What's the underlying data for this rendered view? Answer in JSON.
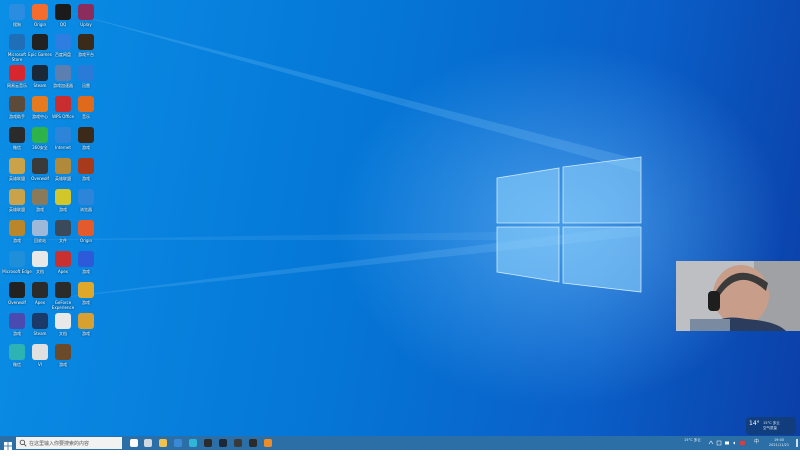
{
  "desktop": {
    "icons": [
      {
        "label": "搜狗",
        "color": "#2a8de0"
      },
      {
        "label": "Origin",
        "color": "#f56c2d"
      },
      {
        "label": "QQ",
        "color": "#1b1b1b"
      },
      {
        "label": "Uplay",
        "color": "#8a2c5c"
      },
      {
        "label": "Microsoft Store",
        "color": "#1f6fb8"
      },
      {
        "label": "Epic Games",
        "color": "#222222"
      },
      {
        "label": "百度网盘",
        "color": "#2e7de1"
      },
      {
        "label": "游戏平台",
        "color": "#3a2a1a"
      },
      {
        "label": "网易云音乐",
        "color": "#d8262e"
      },
      {
        "label": "Steam",
        "color": "#1b2838"
      },
      {
        "label": "游戏加速器",
        "color": "#5a7fb0"
      },
      {
        "label": "迅雷",
        "color": "#2a7ad8"
      },
      {
        "label": "游戏助手",
        "color": "#5c4a3a"
      },
      {
        "label": "游戏中心",
        "color": "#e57a1f"
      },
      {
        "label": "WPS Office",
        "color": "#c92d2d"
      },
      {
        "label": "音乐",
        "color": "#e06a1c"
      },
      {
        "label": "微信",
        "color": "#2b2b2b"
      },
      {
        "label": "360安全",
        "color": "#2db34a"
      },
      {
        "label": "Internet",
        "color": "#2c85d9"
      },
      {
        "label": "游戏",
        "color": "#3b2a1a"
      },
      {
        "label": "英雄联盟",
        "color": "#c9a24a"
      },
      {
        "label": "Overwolf",
        "color": "#3a3a3a"
      },
      {
        "label": "英雄联盟",
        "color": "#b08a3a"
      },
      {
        "label": "游戏",
        "color": "#a63a1a"
      },
      {
        "label": "英雄联盟",
        "color": "#c9a24a"
      },
      {
        "label": "游戏",
        "color": "#8a7a5a"
      },
      {
        "label": "游戏",
        "color": "#d3c62a"
      },
      {
        "label": "浏览器",
        "color": "#2c85d9"
      },
      {
        "label": "游戏",
        "color": "#b9872a"
      },
      {
        "label": "回收站",
        "color": "#9db8d8"
      },
      {
        "label": "文件",
        "color": "#3a4a5a"
      },
      {
        "label": "Origin",
        "color": "#e35a2d"
      },
      {
        "label": "Microsoft Edge",
        "color": "#1e8fd8"
      },
      {
        "label": "文档",
        "color": "#e8e8e8"
      },
      {
        "label": "Apex",
        "color": "#c93030"
      },
      {
        "label": "游戏",
        "color": "#2c5ad8"
      },
      {
        "label": "Overwolf",
        "color": "#222222"
      },
      {
        "label": "Apex",
        "color": "#2b2b2b"
      },
      {
        "label": "GeForce Experience",
        "color": "#2b2b2b"
      },
      {
        "label": "游戏",
        "color": "#e0a82a"
      },
      {
        "label": "游戏",
        "color": "#4a4ab0"
      },
      {
        "label": "Steam",
        "color": "#1b3a6a"
      },
      {
        "label": "文档",
        "color": "#e8e8e8"
      },
      {
        "label": "游戏",
        "color": "#d8a030"
      },
      {
        "label": "微信",
        "color": "#2db3b3"
      },
      {
        "label": "VI",
        "color": "#e0e0e0"
      },
      {
        "label": "游戏",
        "color": "#6a4a2a"
      }
    ]
  },
  "taskbar": {
    "search_placeholder": "在这里输入你要搜索的内容",
    "apps": [
      {
        "name": "task-view",
        "color": "#ffffff"
      },
      {
        "name": "widgets",
        "color": "#d0d8e0"
      },
      {
        "name": "file-explorer",
        "color": "#f2c14e"
      },
      {
        "name": "mail",
        "color": "#3a8ad8"
      },
      {
        "name": "edge",
        "color": "#2fb6d8"
      },
      {
        "name": "store",
        "color": "#2b2b2b"
      },
      {
        "name": "steam",
        "color": "#1b2838"
      },
      {
        "name": "app",
        "color": "#3a3a3a"
      },
      {
        "name": "obs",
        "color": "#2b2b2b"
      },
      {
        "name": "app",
        "color": "#f08c28"
      }
    ],
    "tray": {
      "weather_small": "15°C 多云",
      "lang": "中",
      "time": "19:00",
      "date": "2021/11/21"
    }
  },
  "weather_widget": {
    "temp": "14°",
    "desc": "15°C 多云",
    "desc2": "空气质量"
  }
}
